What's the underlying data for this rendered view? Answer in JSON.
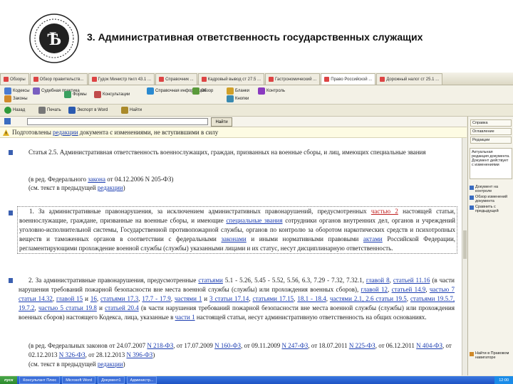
{
  "slide": {
    "title": "3. Административная ответственность государственных служащих"
  },
  "tabs": [
    {
      "label": "Обзоры"
    },
    {
      "label": "Обзор правительств..."
    },
    {
      "label": "Гудок Министр №гл 43.1 ..."
    },
    {
      "label": "Справочник ..."
    },
    {
      "label": "Кадровый вывод ст 27.5 ..."
    },
    {
      "label": "Гастрономический ..."
    },
    {
      "label": "Право Российской ..."
    },
    {
      "label": "Дорожный налог ст 25.1 ..."
    }
  ],
  "toolbar1": {
    "items": [
      "Кодексы",
      "Законы",
      "Судебная практика",
      "Формы",
      "Консультации",
      "Справочная информация",
      "Обзор",
      "Бланки",
      "Контроль",
      "Кнопки"
    ]
  },
  "toolbar2": {
    "items": [
      "Назад",
      "Печать",
      "Экспорт в Word",
      "Найти"
    ]
  },
  "search": {
    "value": "",
    "button": "Найти"
  },
  "notice": {
    "prefix": "Подготовлены ",
    "link": "редакции",
    "suffix": " документа с изменениями, не вступившими в силу"
  },
  "doc": {
    "article_title": "Статья 2.5. Административная ответственность военнослужащих, граждан, призванных на военные сборы, и лиц, имеющих специальные звания",
    "rev1_a": "(в ред. Федерального ",
    "rev1_link": "закона",
    "rev1_b": " от 04.12.2006 N 205-ФЗ)",
    "prev1_a": "(см. текст в предыдущей ",
    "prev1_link": "редакции",
    "prev1_b": ")",
    "p1_a": "1. За административные правонарушения, за исключением административных правонарушений, предусмотренных ",
    "p1_link1": "частью 2",
    "p1_b": " настоящей статьи, военнослужащие, граждане, призванные на военные сборы, и имеющие ",
    "p1_link2": "специальные звания",
    "p1_c": " сотрудники органов внутренних дел, органов и учреждений уголовно-исполнительной системы, Государственной противопожарной службы, органов по контролю за оборотом наркотических средств и психотропных веществ и таможенных органов в соответствии с федеральными ",
    "p1_link3": "законами",
    "p1_d": " и иными нормативными правовыми ",
    "p1_link4": "актами",
    "p1_e": " Российской Федерации, регламентирующими прохождение военной службы (службы) указанными лицами и их статус, несут дисциплинарную ответственность.",
    "p2_a": "2. За административные правонарушения, предусмотренные ",
    "p2_l1": "статьями",
    "p2_b": " 5.1 - 5.26, 5.45 - 5.52, 5.56, 6.3, 7.29 - 7.32, 7.32.1, ",
    "p2_l2": "главой 8",
    "p2_c": ", ",
    "p2_l3": "статьей 11.16",
    "p2_d": " (в части нарушения требований пожарной безопасности вне места военной службы (службы) или прохождения военных сборов), ",
    "p2_l4": "главой 12",
    "p2_e": ", ",
    "p2_l5": "статьей 14.9",
    "p2_f": ", ",
    "p2_l6": "частью 7 статьи 14.32",
    "p2_g": ", ",
    "p2_l7": "главой 15",
    "p2_h": " и ",
    "p2_l8": "16",
    "p2_i": ", ",
    "p2_l9": "статьями 17.3",
    "p2_j": ", ",
    "p2_l10": "17.7 - 17.9",
    "p2_k": ", ",
    "p2_l11": "частями 1",
    "p2_l": " и ",
    "p2_l12": "3 статьи 17.14",
    "p2_m": ", ",
    "p2_l13": "статьями 17.15",
    "p2_n": ", ",
    "p2_l14": "18.1 - 18.4",
    "p2_o": ", ",
    "p2_l15": "частями 2.1, 2.6 статьи 19.5",
    "p2_p": ", ",
    "p2_l16": "статьями 19.5.7, 19.7.2",
    "p2_q": ", ",
    "p2_l17": "частью 5 статьи 19.8",
    "p2_r": " и ",
    "p2_l18": "статьей 20.4",
    "p2_s": " (в части нарушения требований пожарной безопасности вне места военной службы (службы) или прохождения военных сборов) настоящего Кодекса, лица, указанные в ",
    "p2_l19": "части 1",
    "p2_t": " настоящей статьи, несут административную ответственность на общих основаниях.",
    "rev2_a": "(в ред. Федеральных законов от 24.07.2007 ",
    "rev2_l1": "N 218-ФЗ",
    "rev2_b": ", от 17.07.2009 ",
    "rev2_l2": "N 160-ФЗ",
    "rev2_c": ", от 09.11.2009 ",
    "rev2_l3": "N 247-ФЗ",
    "rev2_d": ", от 18.07.2011 ",
    "rev2_l4": "N 225-ФЗ",
    "rev2_e": ", от 06.12.2011 ",
    "rev2_l5": "N 404-ФЗ",
    "rev2_f": ", от 02.12.2013 ",
    "rev2_l6": "N 326-ФЗ",
    "rev2_g": ", от 28.12.2013 ",
    "rev2_l7": "N 396-ФЗ",
    "rev2_h": ")",
    "prev2_a": "(см. текст в предыдущей ",
    "prev2_link": "редакции",
    "prev2_b": ")"
  },
  "sidepanel": {
    "items": [
      "Справка",
      "Оглавление",
      "Редакции"
    ],
    "box": "Актуальная редакция документа. Документ действует с изменениями",
    "links": [
      "Документ на контроле",
      "Обзор изменений документа",
      "Сравнить с предыдущей"
    ],
    "bottom": "Найти в Правовом навигаторе"
  },
  "taskbar": {
    "start": "пуск",
    "tasks": [
      "Консультант Плюс",
      "Microsoft Word",
      "Документ1",
      "Администр..."
    ],
    "clock": "12:00"
  },
  "colors": {
    "link": "#1a3cb0",
    "link_changed": "#c02020",
    "notice_bg": "#fdfbe3",
    "taskbar": "#1d52c4"
  }
}
